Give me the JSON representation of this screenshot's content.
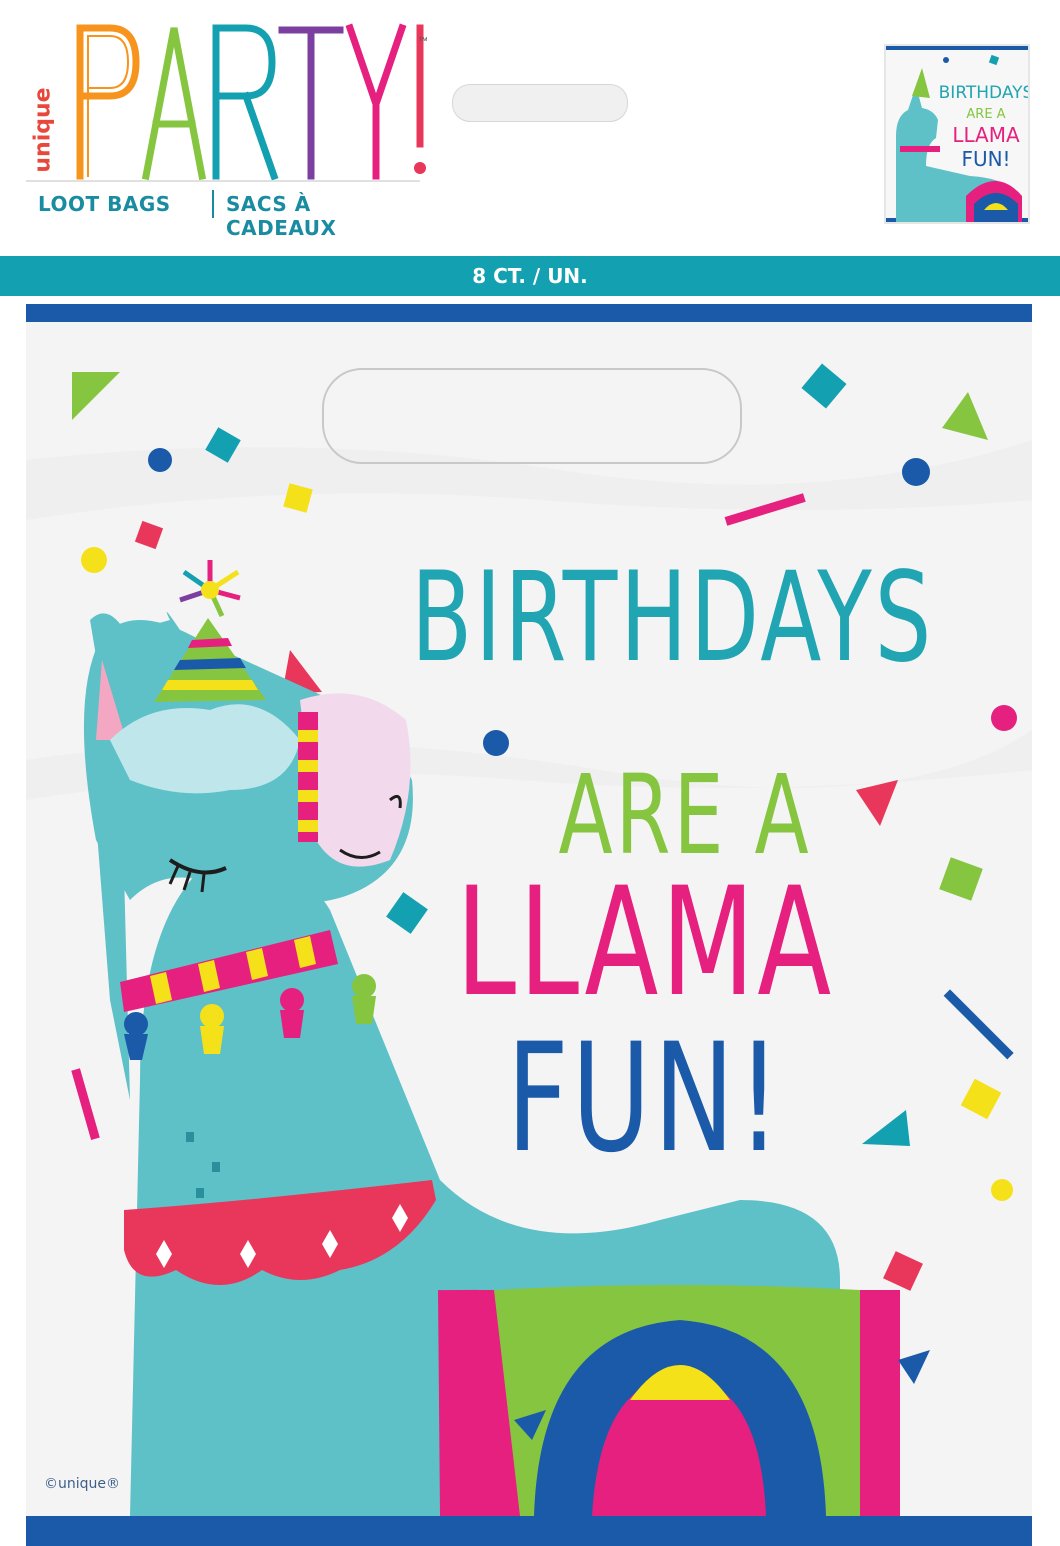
{
  "brand": {
    "name": "unique",
    "line": "PARTY!",
    "trademark": "™"
  },
  "product": {
    "type_en": "LOOT BAGS",
    "type_fr": "SACS À CADEAUX",
    "count": "8 CT. / UN."
  },
  "thumbnail": {
    "line1": "BIRTHDAYS",
    "line2": "ARE A",
    "line3": "LLAMA",
    "line4": "FUN!"
  },
  "headline": {
    "line1": "BIRTHDAYS",
    "line2": "ARE A",
    "line3": "LLAMA",
    "line4": "FUN!"
  },
  "copyright": "©unique®",
  "colors": {
    "teal": "#21a5b2",
    "green": "#86c540",
    "pink": "#e5207f",
    "blue": "#1a5aa9",
    "yellow": "#f5e11a",
    "red": "#e8375a"
  }
}
